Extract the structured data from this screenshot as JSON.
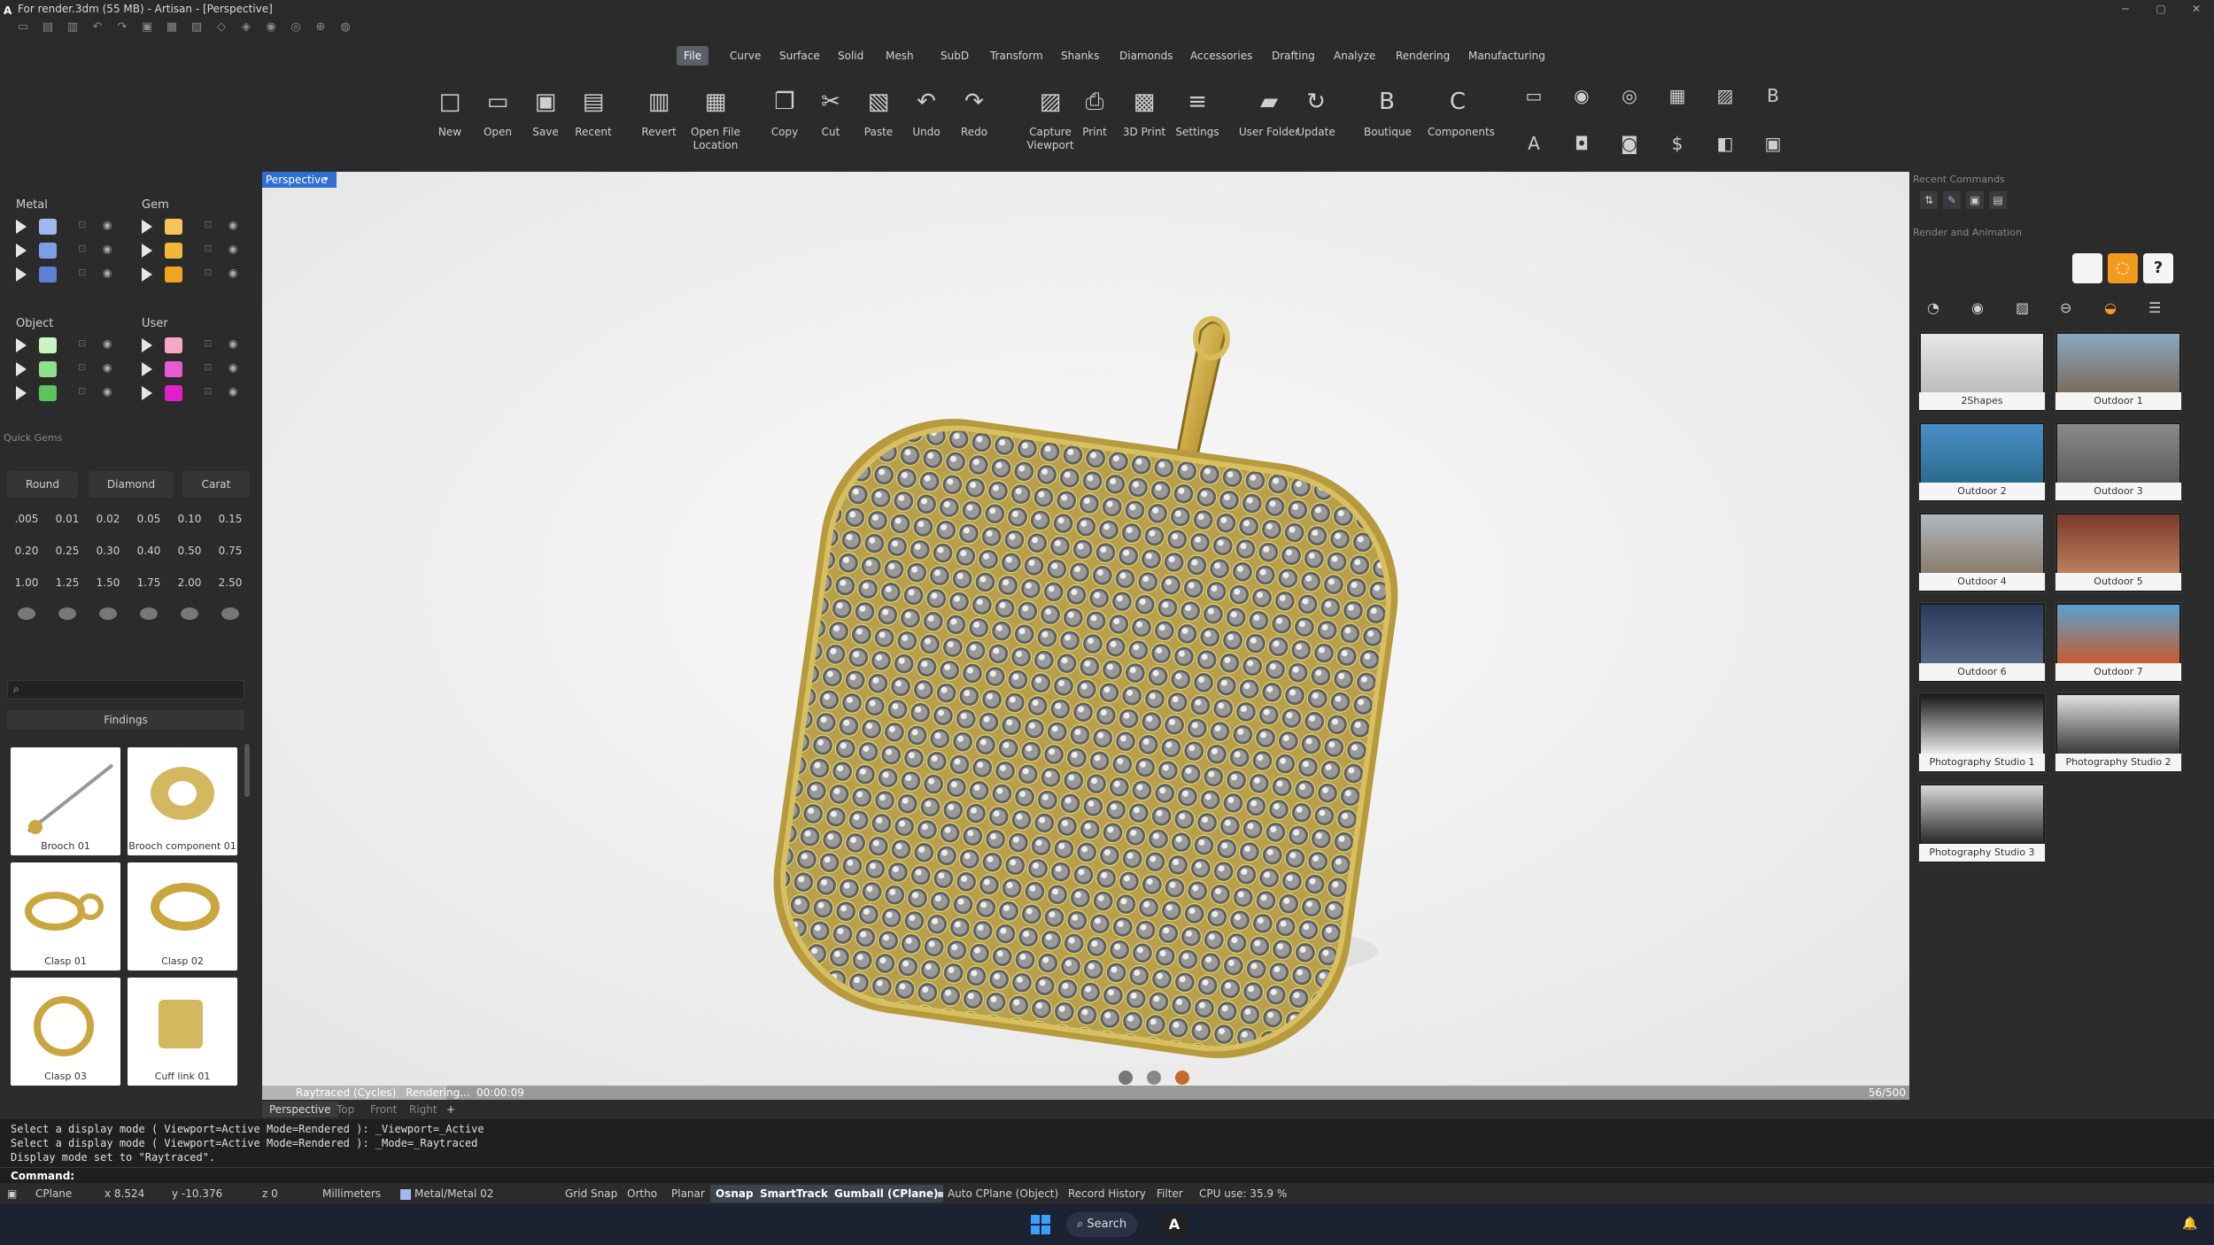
{
  "window": {
    "title": "For render.3dm (55 MB) - Artisan - [Perspective]"
  },
  "menus": [
    "File",
    "Curve",
    "Surface",
    "Solid",
    "Mesh",
    "SubD",
    "Transform",
    "Shanks",
    "Diamonds",
    "Accessories",
    "Drafting",
    "Analyze",
    "Rendering",
    "Manufacturing"
  ],
  "ribbon": {
    "buttons": [
      {
        "label": "New",
        "icon": "□"
      },
      {
        "label": "Open",
        "icon": "▭"
      },
      {
        "label": "Save",
        "icon": "▣"
      },
      {
        "label": "Recent",
        "icon": "▤"
      },
      {
        "label": "Revert",
        "icon": "▥"
      },
      {
        "label": "Open File Location",
        "icon": "▦"
      },
      {
        "label": "Copy",
        "icon": "❐"
      },
      {
        "label": "Cut",
        "icon": "✂"
      },
      {
        "label": "Paste",
        "icon": "▧"
      },
      {
        "label": "Undo",
        "icon": "↶"
      },
      {
        "label": "Redo",
        "icon": "↷"
      },
      {
        "label": "Capture Viewport",
        "icon": "▨"
      },
      {
        "label": "Print",
        "icon": "⎙"
      },
      {
        "label": "3D Print",
        "icon": "▩"
      },
      {
        "label": "Settings",
        "icon": "≡"
      },
      {
        "label": "User Folder",
        "icon": "▰"
      },
      {
        "label": "Update",
        "icon": "↻"
      },
      {
        "label": "Boutique",
        "icon": "B"
      },
      {
        "label": "Components",
        "icon": "C"
      }
    ],
    "small_icons": [
      "▭",
      "◉",
      "◎",
      "▦",
      "▨",
      "B",
      "A",
      "◘",
      "◙",
      "$",
      "◧",
      "▣"
    ]
  },
  "layers": {
    "metal": {
      "title": "Metal",
      "colors": [
        "#9fb8ef",
        "#7e9fe8",
        "#5e7fd6"
      ]
    },
    "gem": {
      "title": "Gem",
      "colors": [
        "#f5c45a",
        "#f5b43a",
        "#f0a420"
      ]
    },
    "object": {
      "title": "Object",
      "colors": [
        "#c9f5c0",
        "#8fe08a",
        "#5cc45a"
      ]
    },
    "user": {
      "title": "User",
      "colors": [
        "#f5a8c8",
        "#e85ad0",
        "#e020c8"
      ]
    }
  },
  "quick_gems": {
    "title": "Quick Gems",
    "shape_buttons": [
      "Round",
      "Diamond",
      "Carat"
    ],
    "carats": [
      [
        ".005",
        "0.01",
        "0.02",
        "0.05",
        "0.10",
        "0.15"
      ],
      [
        "0.20",
        "0.25",
        "0.30",
        "0.40",
        "0.50",
        "0.75"
      ],
      [
        "1.00",
        "1.25",
        "1.50",
        "1.75",
        "2.00",
        "2.50"
      ]
    ]
  },
  "findings": {
    "title": "Findings",
    "items": [
      "Brooch 01",
      "Brooch component 01",
      "Clasp 01",
      "Clasp 02",
      "Clasp 03",
      "Cuff link 01"
    ]
  },
  "viewport": {
    "name": "Perspective",
    "status": "Raytraced (Cycles)",
    "render_state": "Rendering...",
    "time": "00:00:09",
    "samples": "56/500",
    "progress": 0.112
  },
  "view_tabs": [
    "Perspective",
    "Top",
    "Front",
    "Right"
  ],
  "right_panel": {
    "recent_commands": "Recent Commands",
    "render_title": "Render and Animation",
    "environments": [
      "2Shapes",
      "Outdoor 1",
      "Outdoor 2",
      "Outdoor 3",
      "Outdoor 4",
      "Outdoor 5",
      "Outdoor 6",
      "Outdoor 7",
      "Photography Studio 1",
      "Photography Studio 2",
      "Photography Studio 3"
    ]
  },
  "command_history": [
    "Select a display mode ( Viewport=Active  Mode=Rendered ): _Viewport=_Active",
    "Select a display mode ( Viewport=Active  Mode=Rendered ): _Mode=_Raytraced",
    "Display mode set to \"Raytraced\"."
  ],
  "command_prompt": "Command:",
  "status": {
    "cplane": "CPlane",
    "x": "x 8.524",
    "y": "y -10.376",
    "z": "z 0",
    "units": "Millimeters",
    "layer": "Metal/Metal 02",
    "toggles": [
      {
        "label": "Grid Snap",
        "on": false
      },
      {
        "label": "Ortho",
        "on": false
      },
      {
        "label": "Planar",
        "on": false
      },
      {
        "label": "Osnap",
        "on": true
      },
      {
        "label": "SmartTrack",
        "on": true
      },
      {
        "label": "Gumball (CPlane)",
        "on": true
      }
    ],
    "auto_cplane": "Auto CPlane (Object)",
    "record_history": "Record History",
    "filter": "Filter",
    "cpu": "CPU use: 35.9 %"
  },
  "taskbar": {
    "search": "Search"
  }
}
